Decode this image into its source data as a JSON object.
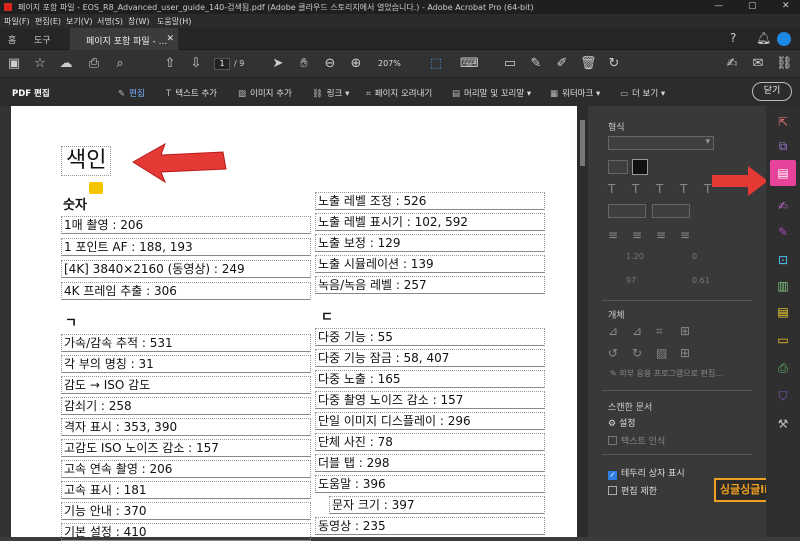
{
  "window": {
    "title": "페이지 포함 파일 - EOS_R8_Advanced_user_guide_140-검색됨.pdf (Adobe 클라우드 스토리지에서 열었습니다.) - Adobe Acrobat Pro (64-bit)"
  },
  "menu": [
    "파일(F)",
    "편집(E)",
    "보기(V)",
    "서명(S)",
    "창(W)",
    "도움말(H)"
  ],
  "tabs": {
    "home": "홈",
    "tools": "도구",
    "doc": "페이지 포함 파일 - ..."
  },
  "toolbar": {
    "page_current": "1",
    "page_total": "/ 9",
    "zoom": "207%"
  },
  "editbar": {
    "title": "PDF 편집",
    "edit": "편집",
    "add_text": "텍스트 추가",
    "add_image": "이미지 추가",
    "link": "링크",
    "crop": "페이지 오려내기",
    "header_footer": "머리말 및 꼬리말",
    "watermark": "워터마크",
    "more": "더 보기",
    "close": "닫기"
  },
  "document": {
    "title": "색인",
    "left_sections": [
      {
        "header": "숫자",
        "items": [
          "1매 촬영 : 206",
          "1 포인트 AF : 188, 193",
          "[4K] 3840×2160 (동영상) : 249",
          "4K 프레임 추출 : 306"
        ]
      },
      {
        "header": "ㄱ",
        "items": [
          "가속/감속 추적 : 531",
          "각 부의 명칭 : 31",
          "감도 → ISO 감도",
          "감쇠기 : 258",
          "격자 표시 : 353, 390",
          "고감도 ISO 노이즈 감소 : 157",
          "고속 연속 촬영 : 206",
          "고속 표시 : 181",
          "기능 안내 : 370",
          "기본 설정 : 410"
        ]
      }
    ],
    "right_sections": [
      {
        "header": "",
        "items": [
          "노출 레벨 조정 : 526",
          "노출 레벨 표시기 : 102, 592",
          "노출 보정 : 129",
          "노출 시뮬레이션 : 139",
          "녹음/녹음 레벨 : 257"
        ]
      },
      {
        "header": "ㄷ",
        "items": [
          "다중 기능 : 55",
          "다중 기능 잠금 : 58, 407",
          "다중 노출 : 165",
          "다중 촬영 노이즈 감소 : 157",
          "단일 이미지 디스플레이 : 296",
          "단체 사진 : 78",
          "더블 탭 : 298",
          "도움말 : 396",
          "문자 크기 : 397",
          "동영상 : 235"
        ]
      }
    ]
  },
  "panel": {
    "format": "형식",
    "font_size": "",
    "object": "개체",
    "external_edit": "외부 응용 프로그램으로 편집...",
    "scanned_doc": "스캔한 문서",
    "settings": "설정",
    "text_recognition": "텍스트 인식",
    "show_bbox": "테두리 상자 표시",
    "edit_limit": "편집 제한",
    "line_spacing": "1.20",
    "char_spacing": "0",
    "scale": "97",
    "tracking": "0.61"
  },
  "watermark_text": "싱글싱글life",
  "colors": {
    "accent": "#d9251b",
    "highlight": "#e8439b",
    "arrow": "#e53935"
  }
}
